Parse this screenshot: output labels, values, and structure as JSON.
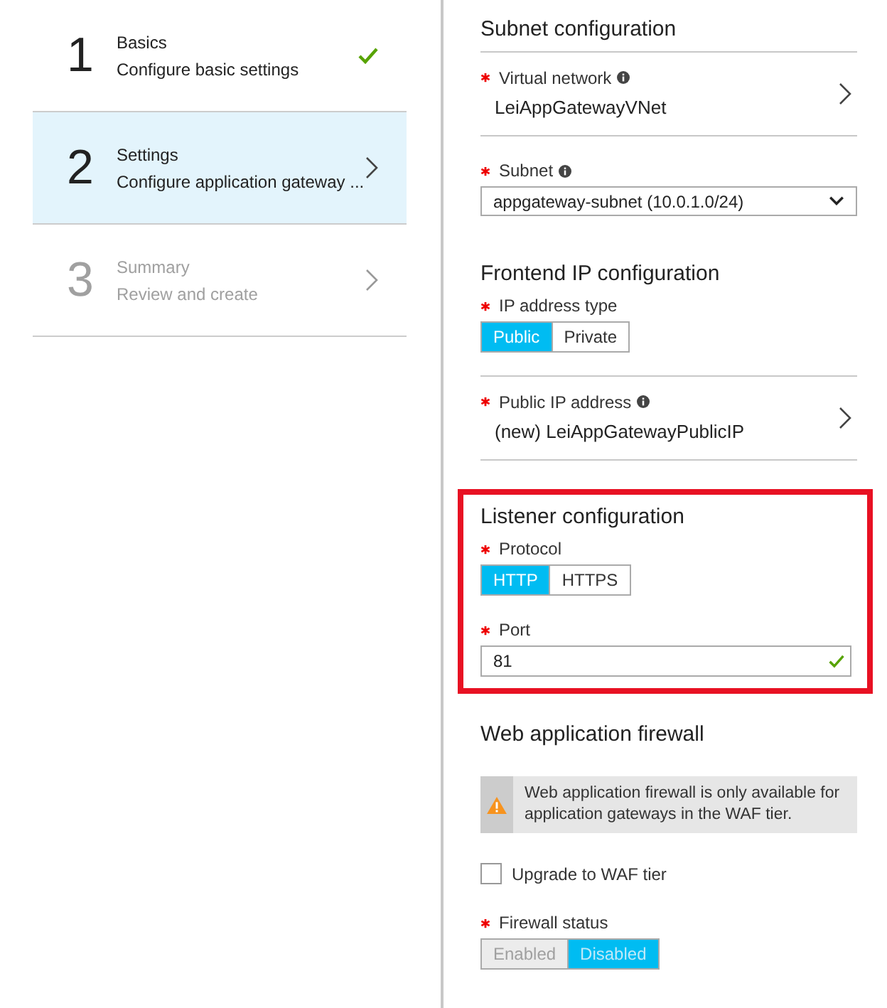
{
  "steps": [
    {
      "number": "1",
      "title": "Basics",
      "subtitle": "Configure basic settings",
      "selected": false,
      "completed": true,
      "disabled": false
    },
    {
      "number": "2",
      "title": "Settings",
      "subtitle": "Configure application gateway ...",
      "selected": true,
      "completed": false,
      "disabled": false
    },
    {
      "number": "3",
      "title": "Summary",
      "subtitle": "Review and create",
      "selected": false,
      "completed": false,
      "disabled": true
    }
  ],
  "sections": [
    {
      "heading": "Subnet configuration",
      "highlighted": false,
      "fields": [
        {
          "kind": "picker",
          "label": "Virtual network",
          "required": true,
          "info": true,
          "value": "LeiAppGatewayVNet"
        },
        {
          "kind": "dropdown",
          "label": "Subnet",
          "required": true,
          "info": true,
          "value": "appgateway-subnet (10.0.1.0/24)"
        }
      ]
    },
    {
      "heading": "Frontend IP configuration",
      "highlighted": false,
      "fields": [
        {
          "kind": "toggle",
          "label": "IP address type",
          "required": true,
          "info": false,
          "disabled": false,
          "options": [
            {
              "label": "Public",
              "selected": true
            },
            {
              "label": "Private",
              "selected": false
            }
          ]
        },
        {
          "kind": "picker",
          "label": "Public IP address",
          "required": true,
          "info": true,
          "value": "(new) LeiAppGatewayPublicIP"
        }
      ]
    },
    {
      "heading": "Listener configuration",
      "highlighted": true,
      "fields": [
        {
          "kind": "toggle",
          "label": "Protocol",
          "required": true,
          "info": false,
          "disabled": false,
          "options": [
            {
              "label": "HTTP",
              "selected": true
            },
            {
              "label": "HTTPS",
              "selected": false
            }
          ]
        },
        {
          "kind": "textbox",
          "label": "Port",
          "required": true,
          "info": false,
          "value": "81",
          "valid": true
        }
      ]
    },
    {
      "heading": "Web application firewall",
      "highlighted": false,
      "fields": [
        {
          "kind": "warning",
          "text": "Web application firewall is only available for application gateways in the WAF tier."
        },
        {
          "kind": "checkbox",
          "label": "Upgrade to WAF tier",
          "checked": false
        },
        {
          "kind": "toggle",
          "label": "Firewall status",
          "required": true,
          "info": false,
          "disabled": true,
          "options": [
            {
              "label": "Enabled",
              "selected": false
            },
            {
              "label": "Disabled",
              "selected": true
            }
          ]
        }
      ]
    }
  ]
}
